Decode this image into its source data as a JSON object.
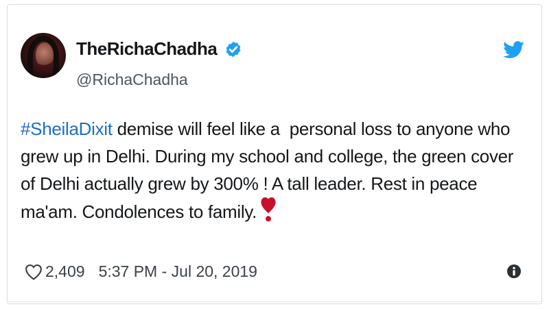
{
  "tweet": {
    "display_name": "TheRichaChadha",
    "handle": "@RichaChadha",
    "hashtag": "#SheilaDixit",
    "text_line1_rest": " demise will feel like a  personal loss to anyone who",
    "text_line2": "grew up in Delhi. During my school and college, the green cover",
    "text_line3": "of Delhi actually grew by 300% ! A tall leader. Rest in peace",
    "text_line4": "ma'am. Condolences to family.",
    "likes": "2,409",
    "timestamp": "5:37 PM - Jul 20, 2019"
  },
  "icons": {
    "verified": "verified-badge-icon",
    "bird": "twitter-bird-icon",
    "like": "heart-outline-icon",
    "emoji": "heavy-heart-exclamation-icon",
    "info": "info-icon"
  },
  "colors": {
    "brand_blue": "#1da1f2",
    "hashtag_blue": "#1b6fc4",
    "emoji_red": "#c8102e"
  }
}
